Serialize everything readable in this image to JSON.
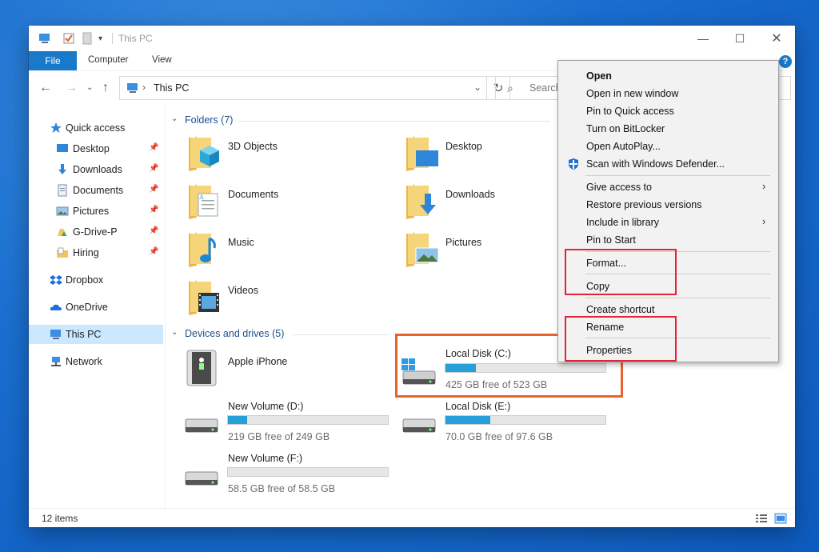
{
  "window": {
    "title": "This PC",
    "controls": [
      "minimize-icon",
      "maximize-icon",
      "close-icon"
    ]
  },
  "ribbon": {
    "file": "File",
    "tabs": [
      "Computer",
      "View"
    ],
    "help": "?"
  },
  "address": {
    "path": "This PC",
    "search_placeholder": "Search"
  },
  "nav": {
    "quick_access": "Quick access",
    "pinned": [
      {
        "label": "Desktop",
        "icon": "desktop-icon"
      },
      {
        "label": "Downloads",
        "icon": "downloads-icon"
      },
      {
        "label": "Documents",
        "icon": "documents-icon"
      },
      {
        "label": "Pictures",
        "icon": "pictures-icon"
      },
      {
        "label": "G-Drive-P",
        "icon": "gdrive-icon"
      },
      {
        "label": "Hiring",
        "icon": "folder-icon"
      }
    ],
    "dropbox": "Dropbox",
    "onedrive": "OneDrive",
    "this_pc": "This PC",
    "network": "Network"
  },
  "folders": {
    "header": "Folders (7)",
    "items": [
      "3D Objects",
      "Desktop",
      "Documents",
      "Downloads",
      "Music",
      "Pictures",
      "Videos"
    ]
  },
  "devices": {
    "header": "Devices and drives (5)",
    "phone": "Apple iPhone",
    "drives": [
      {
        "name": "Local Disk (C:)",
        "free": "425 GB free of 523 GB",
        "used_fraction": 0.19
      },
      {
        "name": "New Volume (D:)",
        "free": "219 GB free of 249 GB",
        "used_fraction": 0.12
      },
      {
        "name": "Local Disk (E:)",
        "free": "70.0 GB free of 97.6 GB",
        "used_fraction": 0.28
      },
      {
        "name": "New Volume (F:)",
        "free": "58.5 GB free of 58.5 GB",
        "used_fraction": 0.0
      }
    ]
  },
  "status": {
    "count": "12 items"
  },
  "context_menu": {
    "items": [
      "Open",
      "Open in new window",
      "Pin to Quick access",
      "Turn on BitLocker",
      "Open AutoPlay...",
      "Scan with Windows Defender...",
      "Give access to",
      "Restore previous versions",
      "Include in library",
      "Pin to Start",
      "Format...",
      "Copy",
      "Create shortcut",
      "Rename",
      "Properties"
    ]
  },
  "colors": {
    "accent": "#1979ca",
    "drive_bar": "#26a0da",
    "highlight_orange": "#e8632b",
    "highlight_red": "#e0243a",
    "folder_yellow": "#f0c75e"
  }
}
